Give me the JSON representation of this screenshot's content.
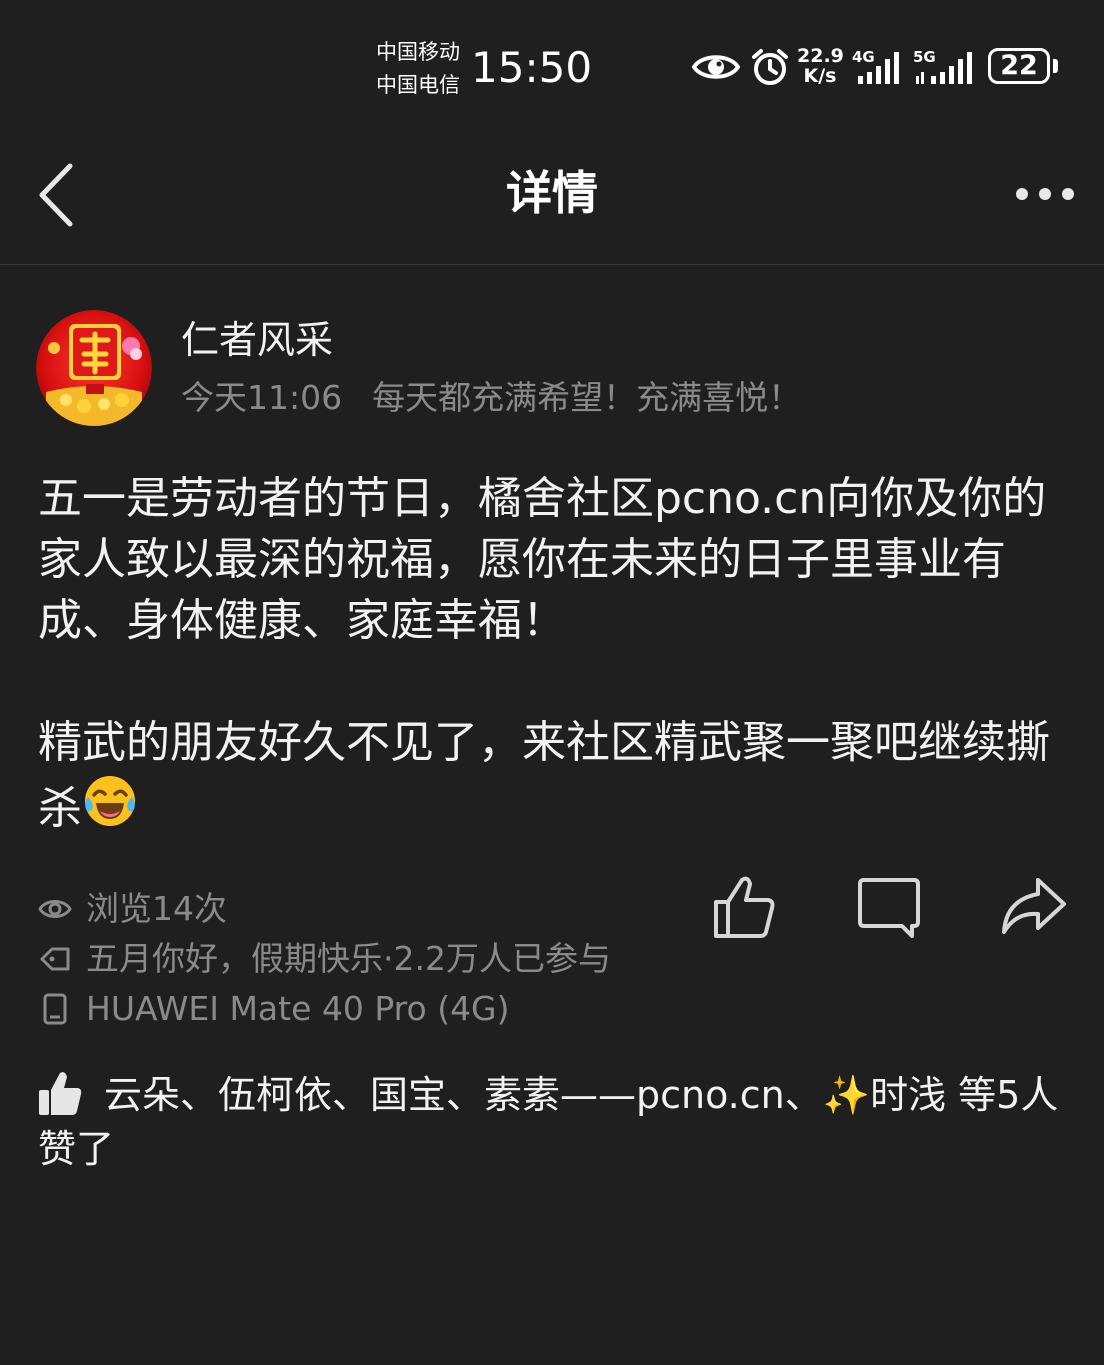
{
  "status_bar": {
    "carrier_1": "中国移动",
    "carrier_2": "中国电信",
    "time": "15:50",
    "speed_value": "22.9",
    "speed_unit": "K/s",
    "net_1": "4G",
    "net_2": "5G",
    "battery": "22",
    "icons": [
      "eye-icon",
      "alarm-icon",
      "signal-4g-icon",
      "signal-5g-icon",
      "battery-icon"
    ]
  },
  "header": {
    "title": "详情",
    "back_icon": "chevron-left-icon",
    "more_icon": "more-dots-icon"
  },
  "post": {
    "author": "仁者风采",
    "avatar_icon": "fu-avatar",
    "time": "今天11:06",
    "signature": "每天都充满希望！充满喜悦！",
    "paragraph_1": "五一是劳动者的节日，橘舍社区pcno.cn向你及你的家人致以最深的祝福，愿你在未来的日子里事业有成、身体健康、家庭幸福！",
    "paragraph_2": "精武的朋友好久不见了，来社区精武聚一聚吧继续撕杀",
    "paragraph_2_emoji": "tears-of-joy-emoji"
  },
  "stats": {
    "views": "浏览14次",
    "topic": "五月你好，假期快乐·2.2万人已参与",
    "device": "HUAWEI Mate 40 Pro (4G)"
  },
  "actions": {
    "like_icon": "thumbs-up-icon",
    "comment_icon": "comment-icon",
    "share_icon": "share-icon"
  },
  "likes": {
    "names": "云朵、伍柯依、国宝、素素——pcno.cn、",
    "sparkle": "✨",
    "last_name": "时浅",
    "suffix": " 等5人赞了"
  },
  "colors": {
    "background": "#1f1f1f",
    "text_primary": "#f2f2f2",
    "text_secondary": "#8a8a8a",
    "divider": "#3a3a3a"
  }
}
